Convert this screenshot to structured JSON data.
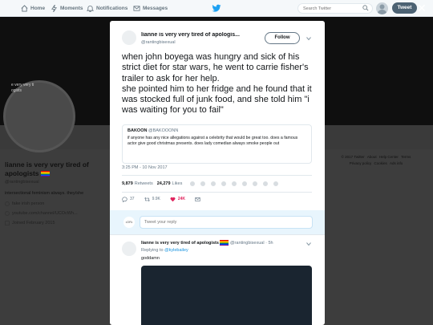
{
  "nav": {
    "home": "Home",
    "moments": "Moments",
    "notifications": "Notifications",
    "messages": "Messages",
    "search_placeholder": "Search Twitter",
    "tweet_button": "Tweet",
    "close": "✕"
  },
  "background_profile": {
    "avatar_text_1": "e very very ti",
    "avatar_text_2": "ogists",
    "name": "lianne is very very tired of apologists",
    "handle": "@rantingbisexual",
    "bio": "intersectional feminism always. they/she",
    "location": "fake irish person",
    "website": "youtube.com/channel/UCOcWh...",
    "joined": "Joined February 2015",
    "footer": [
      "© 2017 Twitter",
      "About",
      "Help Center",
      "Terms",
      "Privacy policy",
      "Cookies",
      "Ads info"
    ]
  },
  "modal": {
    "author_name": "lianne is very very tired of apologis...",
    "author_handle": "@rantingbisexual",
    "follow_label": "Follow",
    "tweet_lines": [
      "when john boyega was hungry and sick of his strict diet for star wars, he went to carrie fisher's trailer to ask for her help.",
      "she pointed him to her fridge and he found that it was stocked full of junk food, and she told him \"i was waiting for you to fail\""
    ],
    "quote": {
      "name": "BAKOON",
      "handle": "@BAKOOONN",
      "text": "if anyone has any nice allegations against a celebrity that would be great too. does a famous actor give good christmas presents. does lady comedian always smoke people out"
    },
    "timestamp": "3:25 PM - 10 Nov 2017",
    "retweets_count": "9,879",
    "retweets_label": "Retweets",
    "likes_count": "24,279",
    "likes_label": "Likes",
    "actions": {
      "reply_count": "37",
      "retweet_count": "9.9K",
      "like_count": "24K"
    },
    "reply_placeholder": "Tweet your reply",
    "reply_avatar_text": "•OR•",
    "reply": {
      "name": "lianne is very very tired of apologists",
      "handle": "@rantingbisexual",
      "time": "· 5h",
      "replying_to_label": "Replying to",
      "replying_to_handle": "@kylebailey",
      "text": "goddamn"
    }
  },
  "colors": {
    "accent": "#1da1f2",
    "like": "#e0245e",
    "tweet_button": "#4c6273"
  }
}
